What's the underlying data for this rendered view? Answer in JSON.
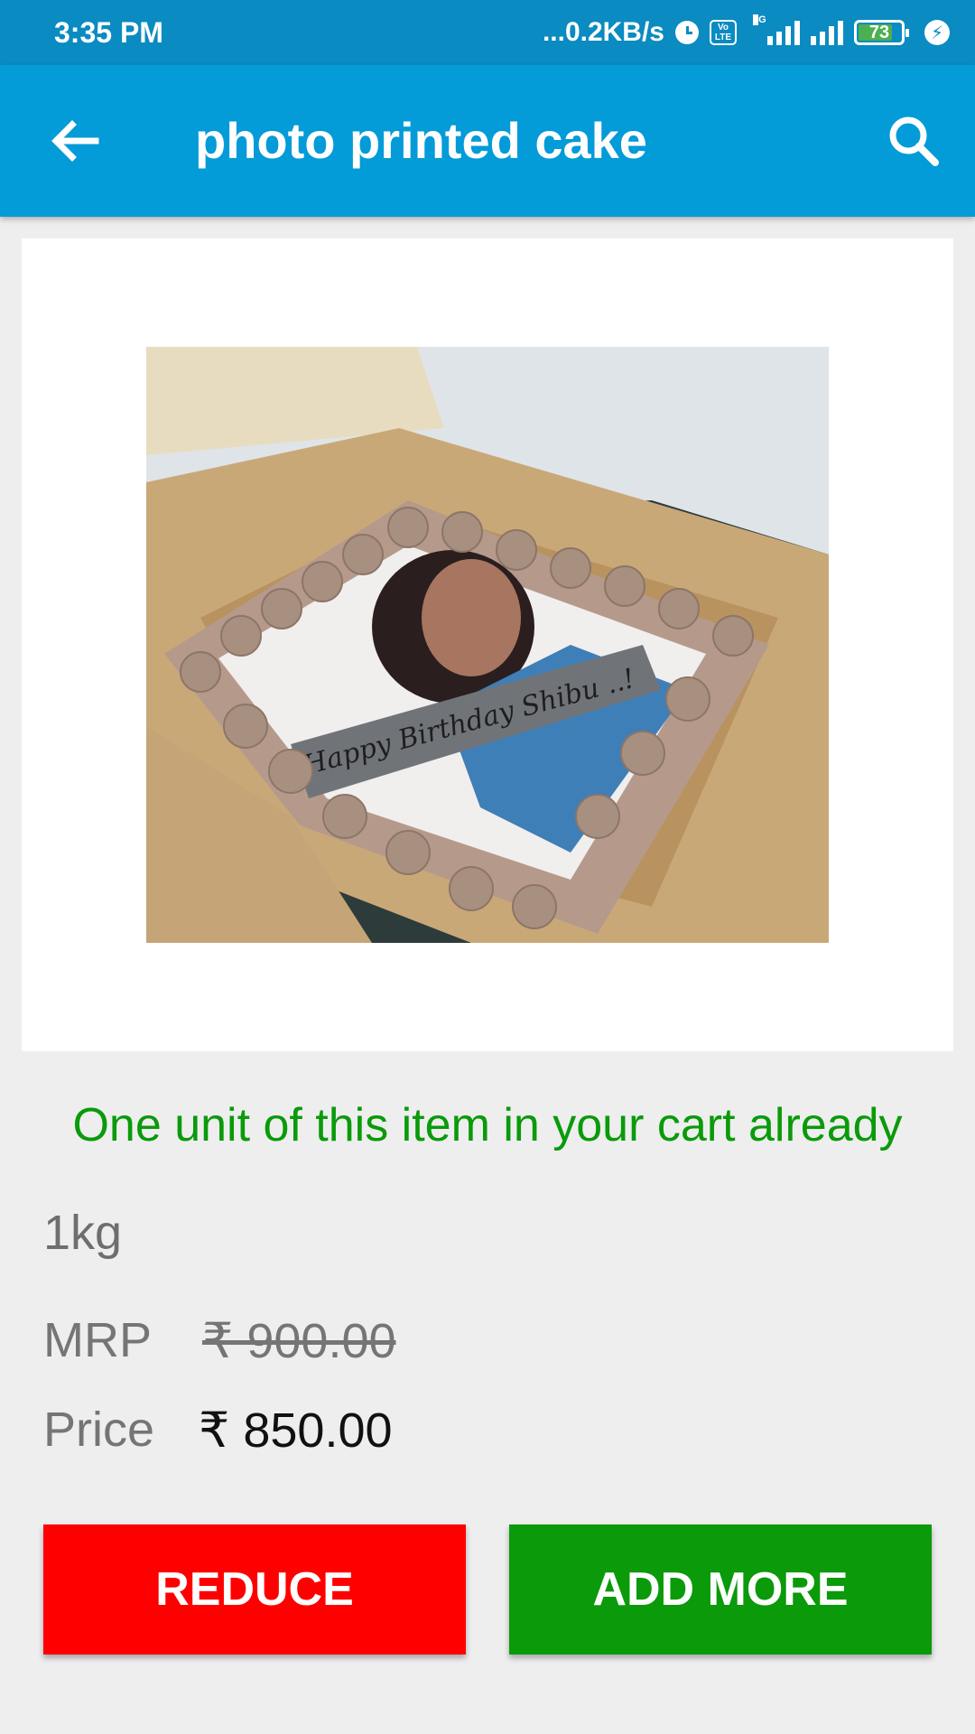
{
  "status_bar": {
    "time": "3:35 PM",
    "net_speed": "...0.2KB/s",
    "volte_top": "Vo",
    "volte_bottom": "LTE",
    "network_type": "4G",
    "battery_level": "73",
    "icons": [
      "alarm-icon",
      "volte-icon",
      "signal-icon",
      "signal-icon",
      "battery-icon",
      "charging-icon"
    ]
  },
  "app_bar": {
    "title": "photo printed cake",
    "back_icon": "arrow-back-icon",
    "search_icon": "search-icon",
    "color": "#039bd8"
  },
  "product": {
    "image_alt": "Photo printed chocolate cake in a box with 'Happy Birthday Shibu' ribbon",
    "image_caption": "Happy Birthday Shibu ..!",
    "cart_notice": "One unit of this item in your cart already",
    "weight": "1kg",
    "mrp_label": "MRP",
    "mrp_value": "₹ 900.00",
    "price_label": "Price",
    "price_value": "₹ 850.00"
  },
  "actions": {
    "reduce_label": "REDUCE",
    "add_more_label": "ADD MORE",
    "reduce_color": "#ff0000",
    "add_more_color": "#0a9a0a"
  }
}
